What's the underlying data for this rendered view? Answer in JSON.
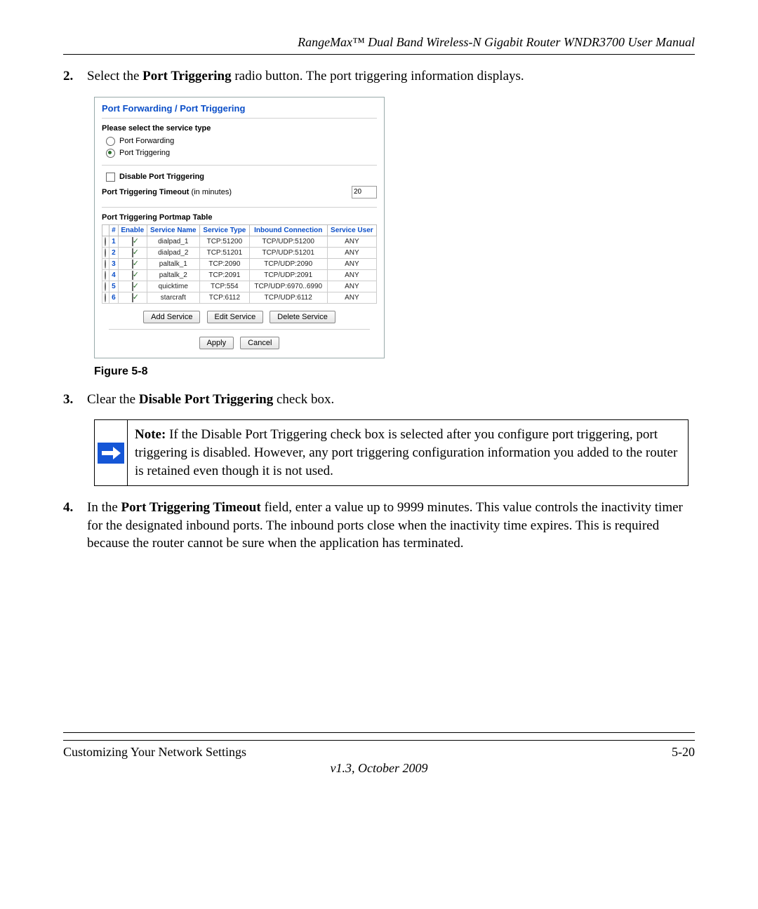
{
  "header": {
    "title": "RangeMax™ Dual Band Wireless-N Gigabit Router WNDR3700 User Manual"
  },
  "steps": {
    "s2": {
      "num": "2.",
      "pre": "Select the ",
      "bold": "Port Triggering",
      "post": " radio button. The port triggering information displays."
    },
    "s3": {
      "num": "3.",
      "pre": "Clear the ",
      "bold": "Disable Port Triggering",
      "post": " check box."
    },
    "s4": {
      "num": "4.",
      "pre": "In the ",
      "bold": "Port Triggering Timeout",
      "post": " field, enter a value up to 9999 minutes. This value controls the inactivity timer for the designated inbound ports. The inbound ports close when the inactivity time expires. This is required because the router cannot be sure when the application has terminated."
    }
  },
  "panel": {
    "title": "Port Forwarding / Port Triggering",
    "select_service": "Please select the service type",
    "radio_forwarding": "Port Forwarding",
    "radio_triggering": "Port Triggering",
    "disable_label": "Disable Port Triggering",
    "timeout_label_a": "Port Triggering Timeout",
    "timeout_label_b": " (in minutes)",
    "timeout_value": "20",
    "table_title": "Port Triggering Portmap Table",
    "headers": {
      "sel": "",
      "idx": "#",
      "enable": "Enable",
      "name": "Service Name",
      "stype": "Service Type",
      "inbound": "Inbound Connection",
      "user": "Service User"
    },
    "rows": [
      {
        "idx": "1",
        "enable": true,
        "name": "dialpad_1",
        "stype": "TCP:51200",
        "inbound": "TCP/UDP:51200",
        "user": "ANY"
      },
      {
        "idx": "2",
        "enable": true,
        "name": "dialpad_2",
        "stype": "TCP:51201",
        "inbound": "TCP/UDP:51201",
        "user": "ANY"
      },
      {
        "idx": "3",
        "enable": true,
        "name": "paltalk_1",
        "stype": "TCP:2090",
        "inbound": "TCP/UDP:2090",
        "user": "ANY"
      },
      {
        "idx": "4",
        "enable": true,
        "name": "paltalk_2",
        "stype": "TCP:2091",
        "inbound": "TCP/UDP:2091",
        "user": "ANY"
      },
      {
        "idx": "5",
        "enable": true,
        "name": "quicktime",
        "stype": "TCP:554",
        "inbound": "TCP/UDP:6970..6990",
        "user": "ANY"
      },
      {
        "idx": "6",
        "enable": true,
        "name": "starcraft",
        "stype": "TCP:6112",
        "inbound": "TCP/UDP:6112",
        "user": "ANY"
      }
    ],
    "buttons": {
      "add": "Add Service",
      "edit": "Edit Service",
      "delete": "Delete Service",
      "apply": "Apply",
      "cancel": "Cancel"
    }
  },
  "figure_caption": "Figure 5-8",
  "note": {
    "bold": "Note:",
    "text": " If the Disable Port Triggering check box is selected after you configure port triggering, port triggering is disabled. However, any port triggering configuration information you added to the router is retained even though it is not used."
  },
  "footer": {
    "left": "Customizing Your Network Settings",
    "right": "5-20",
    "version": "v1.3, October 2009"
  }
}
